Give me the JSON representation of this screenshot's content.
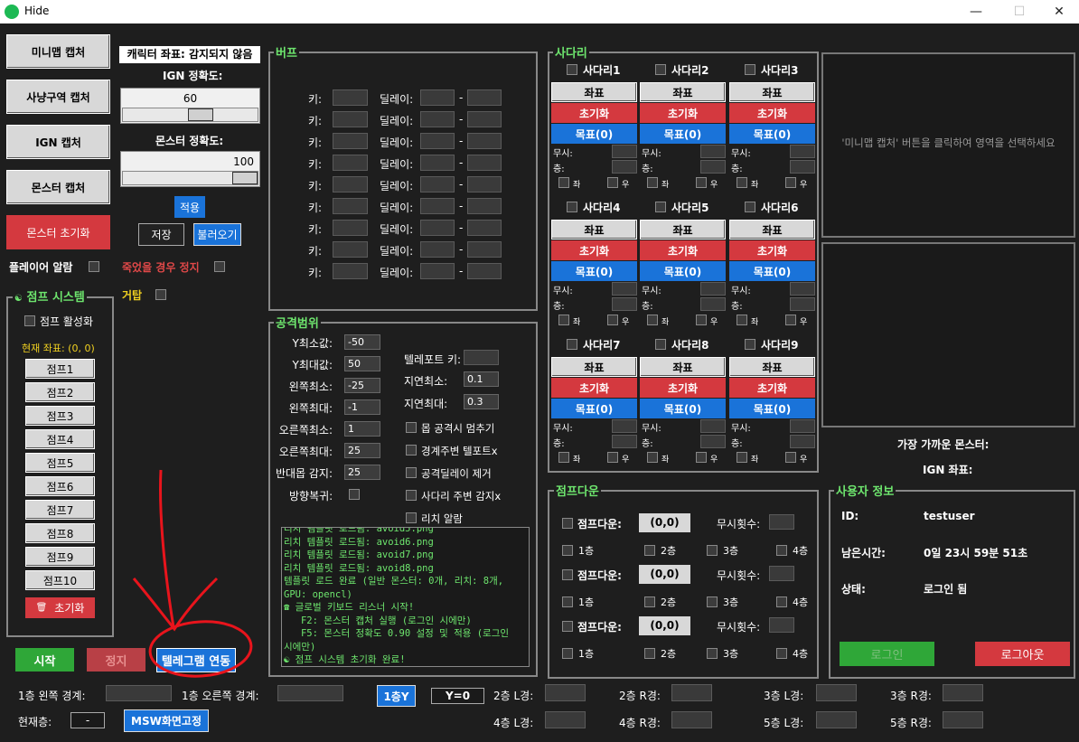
{
  "window": {
    "title": "Hide",
    "minimize": "—",
    "maximize": "☐",
    "close": "✕"
  },
  "left_buttons": {
    "minimap_capture": "미니맵 캡처",
    "hunt_capture": "사냥구역 캡처",
    "ign_capture": "IGN 캡처",
    "monster_capture": "몬스터 캡처",
    "monster_reset": "몬스터 초기화"
  },
  "player_alert": "플레이어 알람",
  "stop_on_death": "죽었을 경우 정지",
  "gatap": "거탑",
  "char_coord": "캐릭터 좌표: 감지되지 않음",
  "ign_accuracy_label": "IGN 정확도:",
  "ign_accuracy_value": "60",
  "monster_accuracy_label": "몬스터 정확도:",
  "monster_accuracy_value": "100",
  "apply": "적용",
  "save": "저장",
  "load": "불러오기",
  "jump_system": {
    "title": "점프 시스템",
    "activate": "점프 활성화",
    "current_coord": "현재 좌표: (0, 0)",
    "jumps": [
      "점프1",
      "점프2",
      "점프3",
      "점프4",
      "점프5",
      "점프6",
      "점프7",
      "점프8",
      "점프9",
      "점프10"
    ],
    "reset": "초기화"
  },
  "buff": {
    "title": "버프",
    "key_label": "키:",
    "delay_label": "딜레이:",
    "dash": "-",
    "row_count": 9
  },
  "attack_range": {
    "title": "공격범위",
    "fields": [
      {
        "label": "Y최소값:",
        "value": "-50"
      },
      {
        "label": "Y최대값:",
        "value": "50"
      },
      {
        "label": "왼쪽최소:",
        "value": "-25"
      },
      {
        "label": "왼쪽최대:",
        "value": "-1"
      },
      {
        "label": "오른쪽최소:",
        "value": "1"
      },
      {
        "label": "오른쪽최대:",
        "value": "25"
      },
      {
        "label": "반대몹 감지:",
        "value": "25"
      }
    ],
    "direction_restore": "방향복귀:",
    "teleport_key": "텔레포트 키:",
    "delay_min": "지연최소:",
    "delay_min_value": "0.1",
    "delay_max": "지연최대:",
    "delay_max_value": "0.3",
    "options": [
      "몹 공격시 멈추기",
      "경계주변 텔포트x",
      "공격딜레이 제거",
      "사다리 주변 감지x",
      "리치 알람"
    ]
  },
  "log_lines": [
    "리치 템플릿 로드됨: avoid5.png",
    "리치 템플릿 로드됨: avoid6.png",
    "리치 템플릿 로드됨: avoid7.png",
    "리치 템플릿 로드됨: avoid8.png",
    "템플릿 로드 완료 (일반 몬스터: 0개, 리치: 8개,",
    "GPU: opencl)",
    "☎ 글로벌 키보드 리스너 시작!",
    "   F2: 몬스터 캡처 실행 (로그인 시에만)",
    "   F5: 몬스터 정확도 0.90 설정 및 적용 (로그인",
    "시에만)",
    "☯ 점프 시스템 초기화 완료!"
  ],
  "ladder": {
    "title": "사다리",
    "names": [
      "사다리1",
      "사다리2",
      "사다리3",
      "사다리4",
      "사다리5",
      "사다리6",
      "사다리7",
      "사다리8",
      "사다리9"
    ],
    "coord": "좌표",
    "reset": "초기화",
    "target": "목표(0)",
    "ignore": "무시:",
    "floor": "층:",
    "left_small": "좌",
    "right_small": "우"
  },
  "minimap_hint": "'미니맵 캡처' 버튼을 클릭하여 영역을 선택하세요",
  "nearest_monster": "가장 가까운 몬스터:",
  "ign_coord": "IGN 좌표:",
  "jump_down": {
    "title": "점프다운",
    "label": "점프다운:",
    "coord": "(0,0)",
    "ignore_count": "무시횟수:",
    "floors": [
      "1층",
      "2층",
      "3층",
      "4층"
    ]
  },
  "user_info": {
    "title": "사용자 정보",
    "id_label": "ID:",
    "id_value": "testuser",
    "remaining_label": "남은시간:",
    "remaining_value": "0일 23시 59분 51초",
    "status_label": "상태:",
    "status_value": "로그인 됨",
    "login": "로그인",
    "logout": "로그아웃"
  },
  "bottom": {
    "start": "시작",
    "stop": "정지",
    "telegram": "텔레그램 연동",
    "floor1_left": "1층 왼쪽 경계:",
    "floor1_right": "1층 오른쪽 경계:",
    "current_floor": "현재층:",
    "current_floor_value": "-",
    "msw_fix": "MSW화면고정",
    "floor1_y": "1층Y",
    "y_value": "Y=0",
    "f2l": "2층 L경:",
    "f2r": "2층 R경:",
    "f3l": "3층 L경:",
    "f3r": "3층 R경:",
    "f4l": "4층 L경:",
    "f4r": "4층 R경:",
    "f5l": "5층 L경:",
    "f5r": "5층 R경:"
  },
  "colors": {
    "accent_green": "#6ee66e",
    "red": "#d4393f",
    "blue": "#1a73d9",
    "annotation": "#e8141c"
  }
}
